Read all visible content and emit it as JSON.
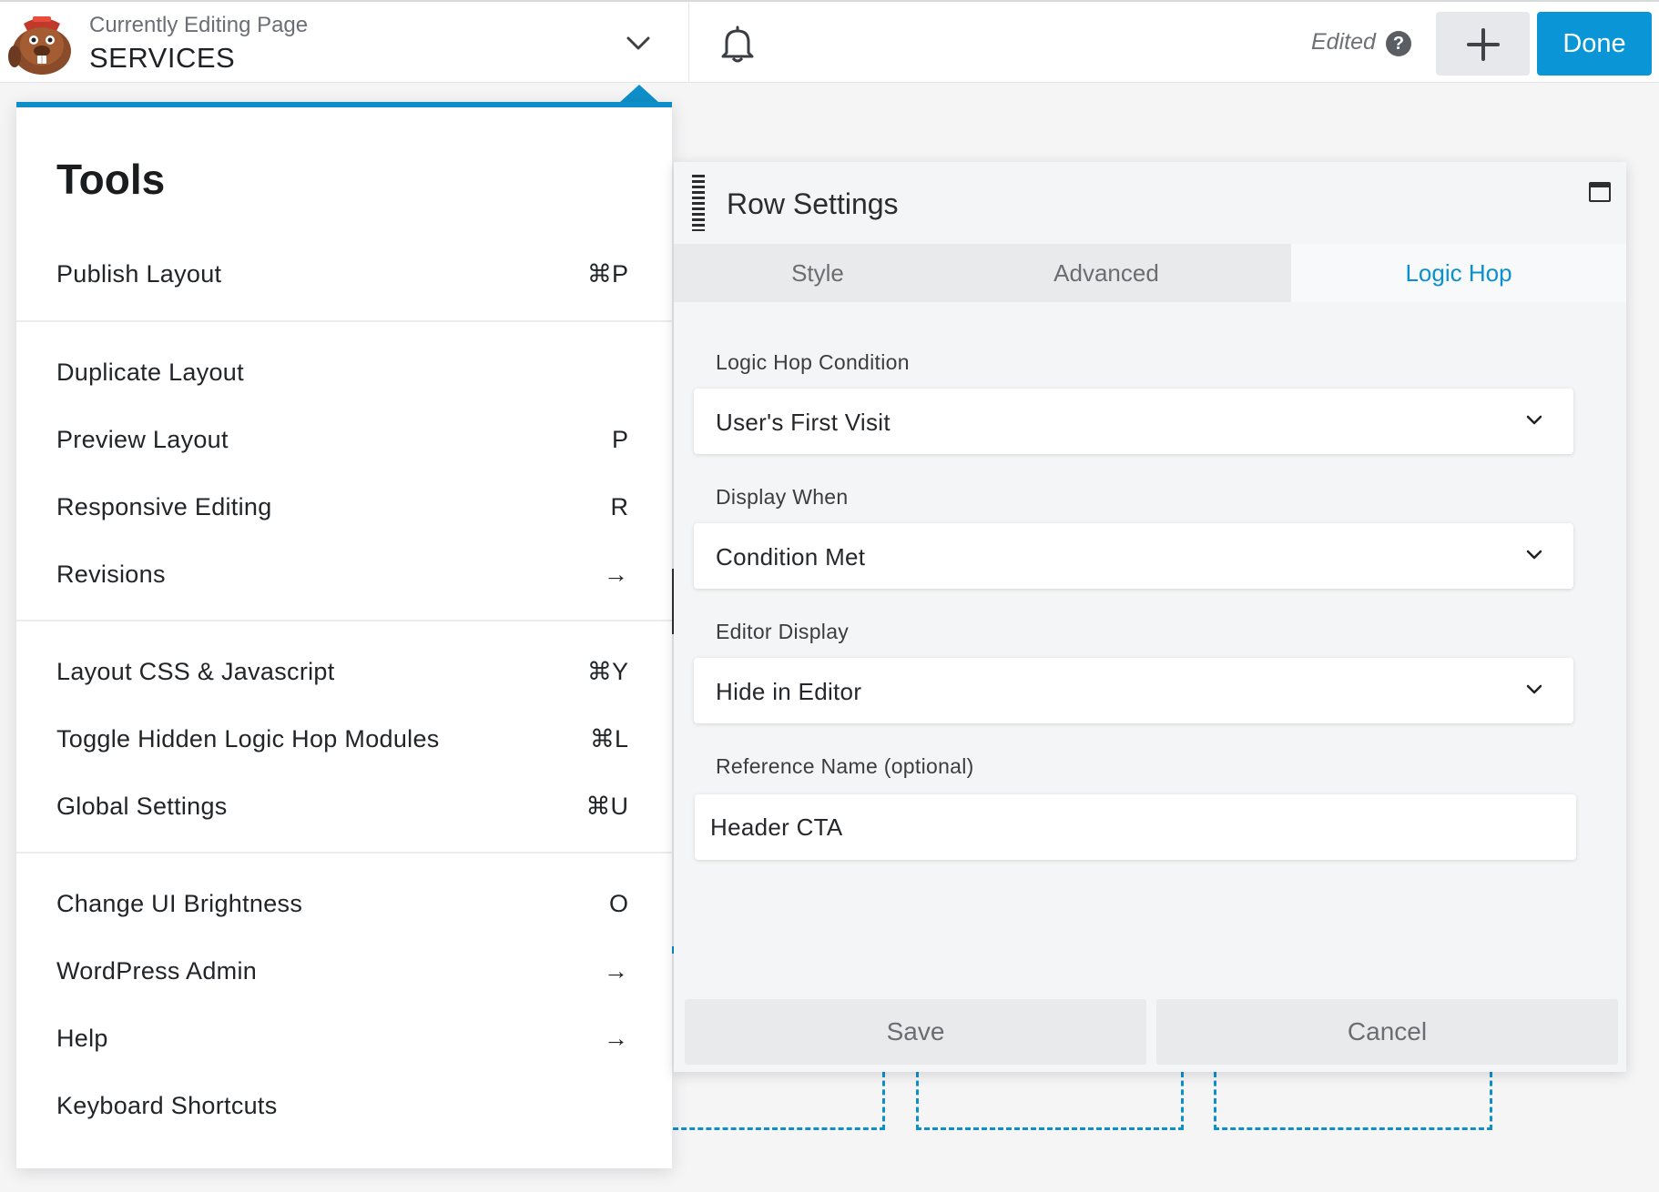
{
  "header": {
    "editing_label": "Currently Editing Page",
    "page_name": "SERVICES",
    "status": "Edited",
    "help_glyph": "?",
    "done_label": "Done",
    "accent_color": "#0a96d6"
  },
  "tools": {
    "title": "Tools",
    "items": [
      {
        "label": "Publish Layout",
        "shortcut": "⌘P"
      },
      {
        "label": "Duplicate Layout",
        "shortcut": ""
      },
      {
        "label": "Preview Layout",
        "shortcut": "P"
      },
      {
        "label": "Responsive Editing",
        "shortcut": "R"
      },
      {
        "label": "Revisions",
        "shortcut": "→"
      },
      {
        "label": "Layout CSS & Javascript",
        "shortcut": "⌘Y"
      },
      {
        "label": "Toggle Hidden Logic Hop Modules",
        "shortcut": "⌘L"
      },
      {
        "label": "Global Settings",
        "shortcut": "⌘U"
      },
      {
        "label": "Change UI Brightness",
        "shortcut": "O"
      },
      {
        "label": "WordPress Admin",
        "shortcut": "→"
      },
      {
        "label": "Help",
        "shortcut": "→"
      },
      {
        "label": "Keyboard Shortcuts",
        "shortcut": ""
      }
    ]
  },
  "row_settings": {
    "title": "Row Settings",
    "tabs": [
      {
        "label": "Style"
      },
      {
        "label": "Advanced"
      },
      {
        "label": "Logic Hop",
        "active": true
      }
    ],
    "fields": {
      "condition": {
        "label": "Logic Hop Condition",
        "value": "User's First Visit"
      },
      "display_when": {
        "label": "Display When",
        "value": "Condition Met"
      },
      "editor_display": {
        "label": "Editor Display",
        "value": "Hide in Editor"
      },
      "reference_name": {
        "label": "Reference Name (optional)",
        "value": "Header CTA"
      }
    },
    "save_label": "Save",
    "cancel_label": "Cancel"
  }
}
